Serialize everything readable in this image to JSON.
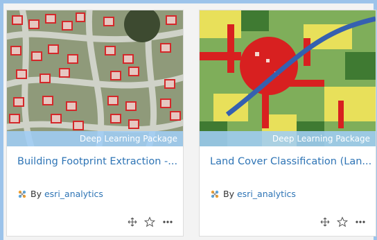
{
  "cards": [
    {
      "badge": "Deep Learning Package",
      "title": "Building Footprint Extraction -...",
      "by": "By",
      "owner": "esri_analytics"
    },
    {
      "badge": "Deep Learning Package",
      "title": "Land Cover Classification (Lan...",
      "by": "By",
      "owner": "esri_analytics"
    }
  ],
  "icons": [
    "package-icon",
    "move-icon",
    "star-icon",
    "more-icon"
  ],
  "colors": {
    "page_bg": "#9cc3ea",
    "panel_bg": "#f3f3f3",
    "link": "#2e74b5",
    "ribbon": "#a0cdf5"
  }
}
